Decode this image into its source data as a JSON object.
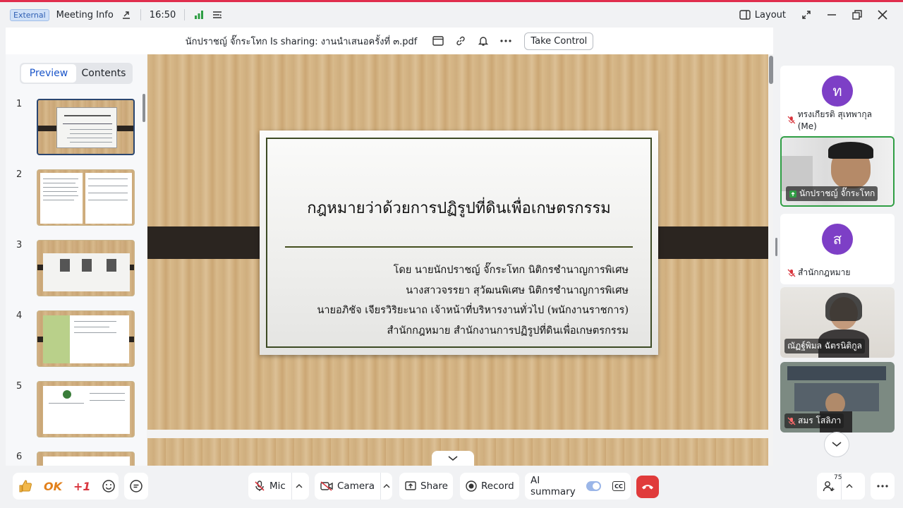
{
  "titlebar": {
    "badge": "External",
    "meeting_info": "Meeting Info",
    "time": "16:50",
    "layout": "Layout"
  },
  "share": {
    "title": "นักปราชญ์ จั๊กระโทก Is sharing: งานนำเสนอครั้งที่ ๓.pdf",
    "take_control": "Take Control"
  },
  "sidebar": {
    "tabs": [
      "Preview",
      "Contents"
    ],
    "active_tab": "Preview",
    "pages": [
      "1",
      "2",
      "3",
      "4",
      "5",
      "6"
    ],
    "selected_page": "1"
  },
  "slide": {
    "title": "กฎหมายว่าด้วยการปฏิรูปที่ดินเพื่อเกษตรกรรม",
    "credits": [
      "โดย นายนักปราชญ์ จั๊กระโทก นิติกรชำนาญการพิเศษ",
      "นางสาวจรรยา สุวัฒนพิเศษ นิติกรชำนาญการพิเศษ",
      "นายอภิชัจ เจียรวิริยะนาถ เจ้าหน้าที่บริหารงานทั่วไป (พนักงานราชการ)",
      "สำนักกฎหมาย สำนักงานการปฏิรูปที่ดินเพื่อเกษตรกรรม"
    ]
  },
  "participants": [
    {
      "initial": "ท",
      "name": "ทรงเกียรติ สุเทพากุล (Me)",
      "muted": true,
      "video": false
    },
    {
      "initial": "",
      "name": "นักปราชญ์ จั๊กระโทก",
      "muted": false,
      "video": true,
      "sharing": true
    },
    {
      "initial": "ส",
      "name": "สำนักกฎหมาย",
      "muted": true,
      "video": false
    },
    {
      "initial": "",
      "name": "ณัฏฐ์พิมล ฉัตรนิติกูล",
      "muted": false,
      "video": true
    },
    {
      "initial": "",
      "name": "สมร โสลิภา",
      "muted": true,
      "video": true
    }
  ],
  "toolbar": {
    "reactions": [
      "OK",
      "+1"
    ],
    "mic": "Mic",
    "camera": "Camera",
    "share": "Share",
    "record": "Record",
    "ai_summary": "AI summary",
    "cc": "CC",
    "participants_count": "75"
  },
  "colors": {
    "accent_red": "#e02e4d",
    "brand_blue": "#1a55c9",
    "hangup": "#e03b3b",
    "avatar": "#7d3fc6"
  }
}
